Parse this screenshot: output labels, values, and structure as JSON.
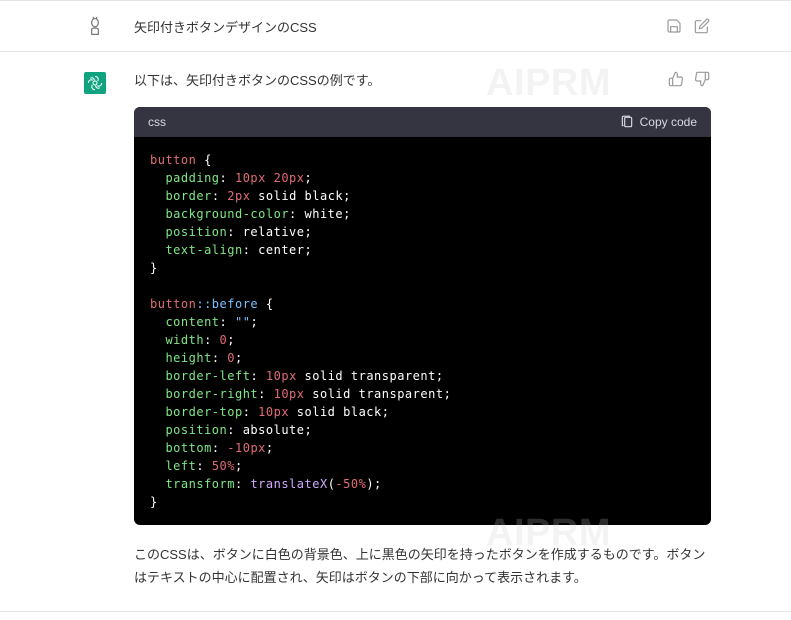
{
  "header": {
    "title": "矢印付きボタンデザインのCSS"
  },
  "watermark": "AIPRM",
  "message": {
    "intro": "以下は、矢印付きボタンのCSSの例です。",
    "explanation": "このCSSは、ボタンに白色の背景色、上に黒色の矢印を持ったボタンを作成するものです。ボタンはテキストの中心に配置され、矢印はボタンの下部に向かって表示されます。"
  },
  "code": {
    "lang": "css",
    "copy_label": "Copy code",
    "lines": {
      "l1_sel": "button",
      "l1_brace": " {",
      "l2_prop": "padding",
      "l2_val": "10px 20px",
      "l3_prop": "border",
      "l3_num": "2px",
      "l3_rest": " solid black",
      "l4_prop": "background-color",
      "l4_val": "white",
      "l5_prop": "position",
      "l5_val": "relative",
      "l6_prop": "text-align",
      "l6_val": "center",
      "l8_sel": "button",
      "l8_pseudo": "::before",
      "l8_brace": " {",
      "l9_prop": "content",
      "l9_val": "\"\"",
      "l10_prop": "width",
      "l10_val": "0",
      "l11_prop": "height",
      "l11_val": "0",
      "l12_prop": "border-left",
      "l12_num": "10px",
      "l12_rest": " solid transparent",
      "l13_prop": "border-right",
      "l13_num": "10px",
      "l13_rest": " solid transparent",
      "l14_prop": "border-top",
      "l14_num": "10px",
      "l14_rest": " solid black",
      "l15_prop": "position",
      "l15_val": "absolute",
      "l16_prop": "bottom",
      "l16_val": "-10px",
      "l17_prop": "left",
      "l17_val": "50%",
      "l18_prop": "transform",
      "l18_func": "translateX",
      "l18_arg": "-50%"
    }
  }
}
